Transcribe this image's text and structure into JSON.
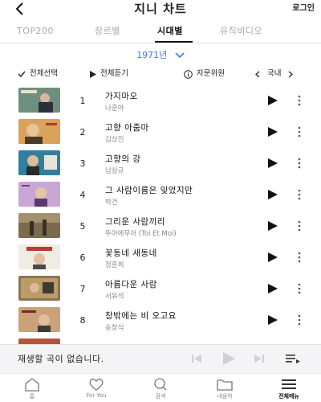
{
  "header": {
    "back_icon": "back-arrow-icon",
    "title": "지니 차트",
    "login_label": "로그인"
  },
  "tabs": [
    {
      "label": "TOP200",
      "active": false
    },
    {
      "label": "장르별",
      "active": false
    },
    {
      "label": "시대별",
      "active": true
    },
    {
      "label": "뮤직비디오",
      "active": false
    }
  ],
  "year_selector": {
    "value": "1971년",
    "icon": "chevron-down-icon"
  },
  "controls": {
    "select_all": "전체선택",
    "play_all": "전체듣기",
    "advisory": "자문위원",
    "region": "국내"
  },
  "songs": [
    {
      "rank": "1",
      "title": "가지마오",
      "artist": "나훈아"
    },
    {
      "rank": "2",
      "title": "고향 아줌마",
      "artist": "김상진"
    },
    {
      "rank": "3",
      "title": "고향의 강",
      "artist": "남상규"
    },
    {
      "rank": "4",
      "title": "그 사람이름은 잊었지만",
      "artist": "박건"
    },
    {
      "rank": "5",
      "title": "그리운 사람끼리",
      "artist": "뚜아에무아 (Toi Et Moi)"
    },
    {
      "rank": "6",
      "title": "꽃동네 새동네",
      "artist": "정훈희"
    },
    {
      "rank": "7",
      "title": "아름다운 사람",
      "artist": "서유석"
    },
    {
      "rank": "8",
      "title": "창밖에는 비 오고요",
      "artist": "송창식"
    }
  ],
  "player": {
    "message": "재생할 곡이 없습니다.",
    "icons": [
      "previous-icon",
      "play-icon",
      "next-icon",
      "playlist-icon"
    ]
  },
  "bottom_nav": [
    {
      "label": "홈",
      "icon": "home-icon",
      "active": false
    },
    {
      "label": "For You",
      "icon": "heart-icon",
      "active": false
    },
    {
      "label": "검색",
      "icon": "search-icon",
      "active": false
    },
    {
      "label": "내음악",
      "icon": "folder-icon",
      "active": false
    },
    {
      "label": "전체메뉴",
      "icon": "menu-icon",
      "active": true
    }
  ],
  "colors": {
    "accent": "#3b78e7",
    "text": "#222222",
    "muted": "#888888",
    "player_bg": "#f4f4f6"
  }
}
